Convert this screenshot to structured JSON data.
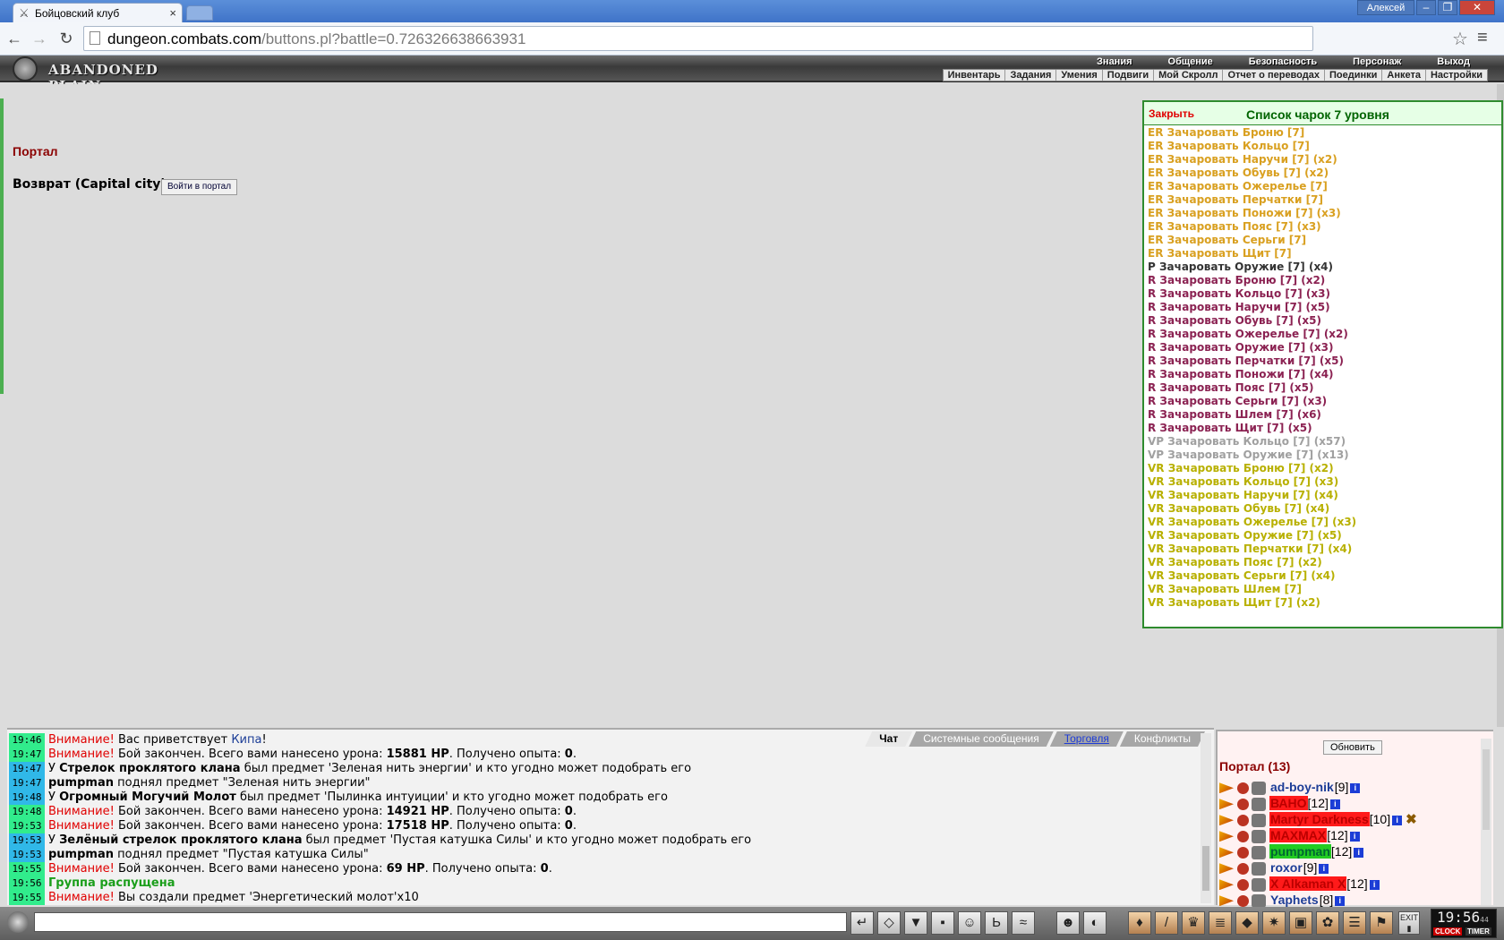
{
  "browser": {
    "tab_title": "Бойцовский клуб",
    "user": "Алексей",
    "url_host": "dungeon.combats.com",
    "url_path": "/buttons.pl?battle=0.726326638663931"
  },
  "game": {
    "logo_text": "ABANDONED PLAIN",
    "top_menu": [
      "Знания",
      "Общение",
      "Безопасность",
      "Персонаж",
      "Выход"
    ],
    "sub_menu": [
      "Инвентарь",
      "Задания",
      "Умения",
      "Подвиги",
      "Мой Скролл",
      "Отчет о переводах",
      "Поединки",
      "Анкета",
      "Настройки"
    ]
  },
  "main": {
    "portal_title": "Портал",
    "return_label": "Возврат (Capital city)",
    "enter_portal_button": "Войти в портал"
  },
  "charm_panel": {
    "close_label": "Закрыть",
    "title": "Список чарок 7 уровня",
    "items": [
      {
        "text": "ER Зачаровать Броню [7]",
        "type": "er"
      },
      {
        "text": "ER Зачаровать Кольцо [7]",
        "type": "er"
      },
      {
        "text": "ER Зачаровать Наручи [7] (x2)",
        "type": "er"
      },
      {
        "text": "ER Зачаровать Обувь [7] (x2)",
        "type": "er"
      },
      {
        "text": "ER Зачаровать Ожерелье [7]",
        "type": "er"
      },
      {
        "text": "ER Зачаровать Перчатки [7]",
        "type": "er"
      },
      {
        "text": "ER Зачаровать Поножи [7] (x3)",
        "type": "er"
      },
      {
        "text": "ER Зачаровать Пояс [7] (x3)",
        "type": "er"
      },
      {
        "text": "ER Зачаровать Серьги [7]",
        "type": "er"
      },
      {
        "text": "ER Зачаровать Щит [7]",
        "type": "er"
      },
      {
        "text": "P Зачаровать Оружие [7] (x4)",
        "type": "p"
      },
      {
        "text": "R Зачаровать Броню [7] (x2)",
        "type": "r"
      },
      {
        "text": "R Зачаровать Кольцо [7] (x3)",
        "type": "r"
      },
      {
        "text": "R Зачаровать Наручи [7] (x5)",
        "type": "r"
      },
      {
        "text": "R Зачаровать Обувь [7] (x5)",
        "type": "r"
      },
      {
        "text": "R Зачаровать Ожерелье [7] (x2)",
        "type": "r"
      },
      {
        "text": "R Зачаровать Оружие [7] (x3)",
        "type": "r"
      },
      {
        "text": "R Зачаровать Перчатки [7] (x5)",
        "type": "r"
      },
      {
        "text": "R Зачаровать Поножи [7] (x4)",
        "type": "r"
      },
      {
        "text": "R Зачаровать Пояс [7] (x5)",
        "type": "r"
      },
      {
        "text": "R Зачаровать Серьги [7] (x3)",
        "type": "r"
      },
      {
        "text": "R Зачаровать Шлем [7] (x6)",
        "type": "r"
      },
      {
        "text": "R Зачаровать Щит [7] (x5)",
        "type": "r"
      },
      {
        "text": "VP Зачаровать Кольцо [7] (x57)",
        "type": "vp"
      },
      {
        "text": "VP Зачаровать Оружие [7] (x13)",
        "type": "vp"
      },
      {
        "text": "VR Зачаровать Броню [7] (x2)",
        "type": "vr"
      },
      {
        "text": "VR Зачаровать Кольцо [7] (x3)",
        "type": "vr"
      },
      {
        "text": "VR Зачаровать Наручи [7] (x4)",
        "type": "vr"
      },
      {
        "text": "VR Зачаровать Обувь [7] (x4)",
        "type": "vr"
      },
      {
        "text": "VR Зачаровать Ожерелье [7] (x3)",
        "type": "vr"
      },
      {
        "text": "VR Зачаровать Оружие [7] (x5)",
        "type": "vr"
      },
      {
        "text": "VR Зачаровать Перчатки [7] (x4)",
        "type": "vr"
      },
      {
        "text": "VR Зачаровать Пояс [7] (x2)",
        "type": "vr"
      },
      {
        "text": "VR Зачаровать Серьги [7] (x4)",
        "type": "vr"
      },
      {
        "text": "VR Зачаровать Шлем [7]",
        "type": "vr"
      },
      {
        "text": "VR Зачаровать Щит [7] (x2)",
        "type": "vr"
      }
    ]
  },
  "chat": {
    "tabs": [
      "Чат",
      "Системные сообщения",
      "Торговля",
      "Конфликты"
    ],
    "active_tab": "Чат",
    "messages": [
      {
        "time": "19:46",
        "color": "g",
        "parts": [
          {
            "t": "Внимание!",
            "s": "warn"
          },
          {
            "t": " Вас приветствует ",
            "s": ""
          },
          {
            "t": "Кипа",
            "s": "sender"
          },
          {
            "t": "!",
            "s": ""
          }
        ]
      },
      {
        "time": "19:47",
        "color": "g",
        "parts": [
          {
            "t": "Внимание!",
            "s": "warn"
          },
          {
            "t": " Бой закончен. Всего вами нанесено урона: ",
            "s": ""
          },
          {
            "t": "15881 HP",
            "s": "b"
          },
          {
            "t": ". Получено опыта: ",
            "s": ""
          },
          {
            "t": "0",
            "s": "b"
          },
          {
            "t": ".",
            "s": ""
          }
        ]
      },
      {
        "time": "19:47",
        "color": "b",
        "parts": [
          {
            "t": "У ",
            "s": ""
          },
          {
            "t": "Стрелок проклятого клана",
            "s": "b"
          },
          {
            "t": " был предмет 'Зеленая нить энергии' и кто угодно может подобрать его",
            "s": ""
          }
        ]
      },
      {
        "time": "19:47",
        "color": "b",
        "parts": [
          {
            "t": "pumpman",
            "s": "b"
          },
          {
            "t": " поднял предмет \"Зеленая нить энергии\"",
            "s": ""
          }
        ]
      },
      {
        "time": "19:48",
        "color": "b",
        "parts": [
          {
            "t": "У ",
            "s": ""
          },
          {
            "t": "Огромный Могучий Молот",
            "s": "b"
          },
          {
            "t": " был предмет 'Пылинка интуиции' и кто угодно может подобрать его",
            "s": ""
          }
        ]
      },
      {
        "time": "19:48",
        "color": "g",
        "parts": [
          {
            "t": "Внимание!",
            "s": "warn"
          },
          {
            "t": " Бой закончен. Всего вами нанесено урона: ",
            "s": ""
          },
          {
            "t": "14921 HP",
            "s": "b"
          },
          {
            "t": ". Получено опыта: ",
            "s": ""
          },
          {
            "t": "0",
            "s": "b"
          },
          {
            "t": ".",
            "s": ""
          }
        ]
      },
      {
        "time": "19:53",
        "color": "g",
        "parts": [
          {
            "t": "Внимание!",
            "s": "warn"
          },
          {
            "t": " Бой закончен. Всего вами нанесено урона: ",
            "s": ""
          },
          {
            "t": "17518 HP",
            "s": "b"
          },
          {
            "t": ". Получено опыта: ",
            "s": ""
          },
          {
            "t": "0",
            "s": "b"
          },
          {
            "t": ".",
            "s": ""
          }
        ]
      },
      {
        "time": "19:53",
        "color": "b",
        "parts": [
          {
            "t": "У ",
            "s": ""
          },
          {
            "t": "Зелёный стрелок проклятого клана",
            "s": "b"
          },
          {
            "t": " был предмет 'Пустая катушка Силы' и кто угодно может подобрать его",
            "s": ""
          }
        ]
      },
      {
        "time": "19:53",
        "color": "b",
        "parts": [
          {
            "t": "pumpman",
            "s": "b"
          },
          {
            "t": " поднял предмет \"Пустая катушка Силы\"",
            "s": ""
          }
        ]
      },
      {
        "time": "19:55",
        "color": "g",
        "parts": [
          {
            "t": "Внимание!",
            "s": "warn"
          },
          {
            "t": " Бой закончен. Всего вами нанесено урона: ",
            "s": ""
          },
          {
            "t": "69 HP",
            "s": "b"
          },
          {
            "t": ". Получено опыта: ",
            "s": ""
          },
          {
            "t": "0",
            "s": "b"
          },
          {
            "t": ".",
            "s": ""
          }
        ]
      },
      {
        "time": "19:56",
        "color": "g",
        "parts": [
          {
            "t": "Группа распущена",
            "s": "grp"
          }
        ]
      },
      {
        "time": "19:55",
        "color": "g",
        "parts": [
          {
            "t": "Внимание!",
            "s": "warn"
          },
          {
            "t": " Вы создали предмет 'Энергетический молот'x10",
            "s": ""
          }
        ]
      }
    ]
  },
  "online": {
    "refresh_button": "Обновить",
    "title": "Портал (13)",
    "users": [
      {
        "name": "ad-boy-nik",
        "level": "[9]",
        "highlight": ""
      },
      {
        "name": "ВАНО",
        "level": "[12]",
        "highlight": "red"
      },
      {
        "name": "Martyr Darkness",
        "level": "[10]",
        "highlight": "red",
        "action": "✖"
      },
      {
        "name": "МАХМАХ",
        "level": "[12]",
        "highlight": "red"
      },
      {
        "name": "pumpman",
        "level": "[12]",
        "highlight": "green"
      },
      {
        "name": "roxor",
        "level": "[9]",
        "highlight": ""
      },
      {
        "name": "X Alkaman X",
        "level": "[12]",
        "highlight": "red"
      },
      {
        "name": "Yaphets",
        "level": "[8]",
        "highlight": ""
      }
    ]
  },
  "bottom": {
    "clock_time": "19:56",
    "clock_seconds": "44",
    "clock_label": "CLOCK",
    "timer_label": "TIMER",
    "exit_label": "EXIT"
  }
}
